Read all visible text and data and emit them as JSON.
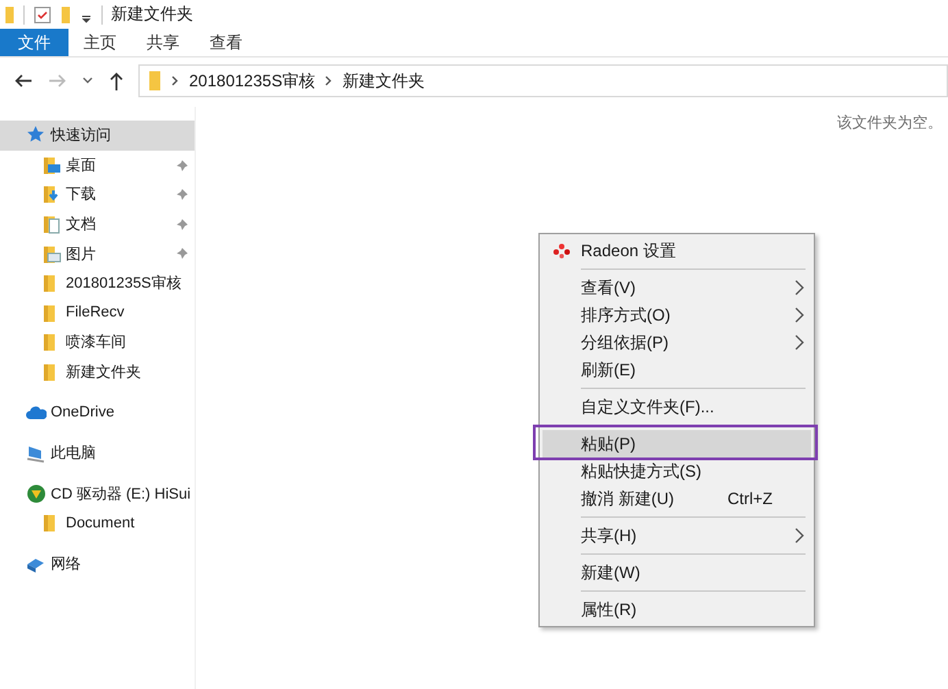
{
  "title_bar": {
    "title": "新建文件夹"
  },
  "ribbon_tabs": [
    {
      "label": "文件",
      "selected": true
    },
    {
      "label": "主页",
      "selected": false
    },
    {
      "label": "共享",
      "selected": false
    },
    {
      "label": "查看",
      "selected": false
    }
  ],
  "address_bar": {
    "back_disabled": false,
    "forward_disabled": true,
    "breadcrumbs": [
      "201801235S审核",
      "新建文件夹"
    ]
  },
  "sidebar": {
    "sections": [
      {
        "items": [
          {
            "label": "快速访问",
            "kind": "star",
            "selected": true,
            "children": [
              {
                "label": "桌面",
                "kind": "desktop",
                "pinned": true,
                "selected": false
              },
              {
                "label": "下载",
                "kind": "download",
                "pinned": true,
                "selected": false
              },
              {
                "label": "文档",
                "kind": "document",
                "pinned": true,
                "selected": false
              },
              {
                "label": "图片",
                "kind": "pictures",
                "pinned": true,
                "selected": false
              },
              {
                "label": "201801235S审核",
                "kind": "folder",
                "pinned": false,
                "selected": false
              },
              {
                "label": "FileRecv",
                "kind": "folder",
                "pinned": false,
                "selected": false
              },
              {
                "label": "喷漆车间",
                "kind": "folder",
                "pinned": false,
                "selected": false
              },
              {
                "label": "新建文件夹",
                "kind": "folder",
                "pinned": false,
                "selected": false
              }
            ]
          }
        ]
      },
      {
        "items": [
          {
            "label": "OneDrive",
            "kind": "cloud",
            "selected": false
          }
        ]
      },
      {
        "items": [
          {
            "label": "此电脑",
            "kind": "computer",
            "selected": false
          }
        ]
      },
      {
        "items": [
          {
            "label": "CD 驱动器 (E:) HiSui",
            "kind": "disc",
            "selected": false,
            "children": [
              {
                "label": "Document",
                "kind": "folder",
                "pinned": false,
                "selected": false
              }
            ]
          }
        ]
      },
      {
        "items": [
          {
            "label": "网络",
            "kind": "network",
            "selected": false
          }
        ]
      }
    ]
  },
  "content": {
    "empty_message": "该文件夹为空。"
  },
  "context_menu": {
    "items": [
      {
        "kind": "app",
        "label": "Radeon 设置",
        "submenu": false,
        "selected": false
      },
      {
        "kind": "separator"
      },
      {
        "kind": "item",
        "label": "查看(V)",
        "submenu": true,
        "selected": false
      },
      {
        "kind": "item",
        "label": "排序方式(O)",
        "submenu": true,
        "selected": false
      },
      {
        "kind": "item",
        "label": "分组依据(P)",
        "submenu": true,
        "selected": false
      },
      {
        "kind": "item",
        "label": "刷新(E)",
        "submenu": false,
        "selected": false
      },
      {
        "kind": "separator"
      },
      {
        "kind": "item",
        "label": "自定义文件夹(F)...",
        "submenu": false,
        "selected": false
      },
      {
        "kind": "separator"
      },
      {
        "kind": "item",
        "label": "粘贴(P)",
        "submenu": false,
        "selected": true
      },
      {
        "kind": "item",
        "label": "粘贴快捷方式(S)",
        "submenu": false,
        "selected": false
      },
      {
        "kind": "item",
        "label": "撤消 新建(U)",
        "shortcut": "Ctrl+Z",
        "submenu": false,
        "selected": false
      },
      {
        "kind": "separator"
      },
      {
        "kind": "item",
        "label": "共享(H)",
        "submenu": true,
        "selected": false
      },
      {
        "kind": "separator"
      },
      {
        "kind": "item",
        "label": "新建(W)",
        "submenu": false,
        "selected": false
      },
      {
        "kind": "separator"
      },
      {
        "kind": "item",
        "label": "属性(R)",
        "submenu": false,
        "selected": false
      }
    ]
  }
}
